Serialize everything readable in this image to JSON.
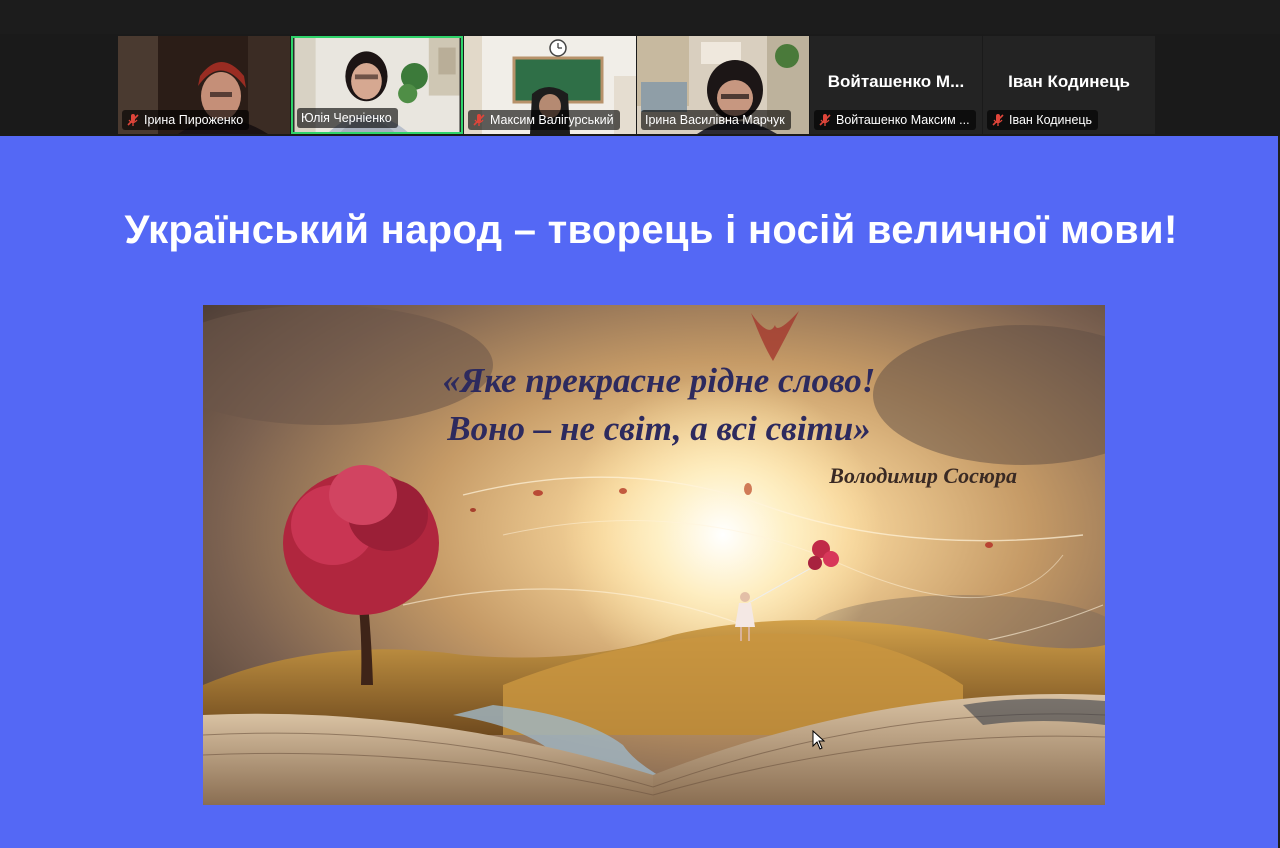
{
  "meeting": {
    "participants": [
      {
        "name": "Ірина Пироженко",
        "muted": true,
        "video": true,
        "active": false
      },
      {
        "name": "Юлія Черніенко",
        "muted": false,
        "video": true,
        "active": true
      },
      {
        "name": "Максим Валігурський",
        "muted": true,
        "video": true,
        "active": false
      },
      {
        "name": "Ірина Василівна Марчук",
        "muted": false,
        "video": true,
        "active": false
      },
      {
        "name": "Войташенко Максим ...",
        "big_name": "Войташенко  М...",
        "muted": true,
        "video": false,
        "active": false
      },
      {
        "name": "Іван Кодинець",
        "big_name": "Іван Кодинець",
        "muted": true,
        "video": false,
        "active": false
      }
    ]
  },
  "slide": {
    "title": "Український народ – творець і носій величної мови!",
    "quote_line_1": "«Яке прекрасне рідне слово!",
    "quote_line_2": "Воно – не світ, а всі світи»",
    "quote_author": "Володимир Сосюра"
  },
  "colors": {
    "slide_background": "#5468f5",
    "active_speaker_border": "#2fd36a",
    "muted_icon": "#e0453a"
  },
  "icons": {
    "muted_mic": "microphone-muted-icon",
    "cursor": "mouse-pointer-icon"
  }
}
